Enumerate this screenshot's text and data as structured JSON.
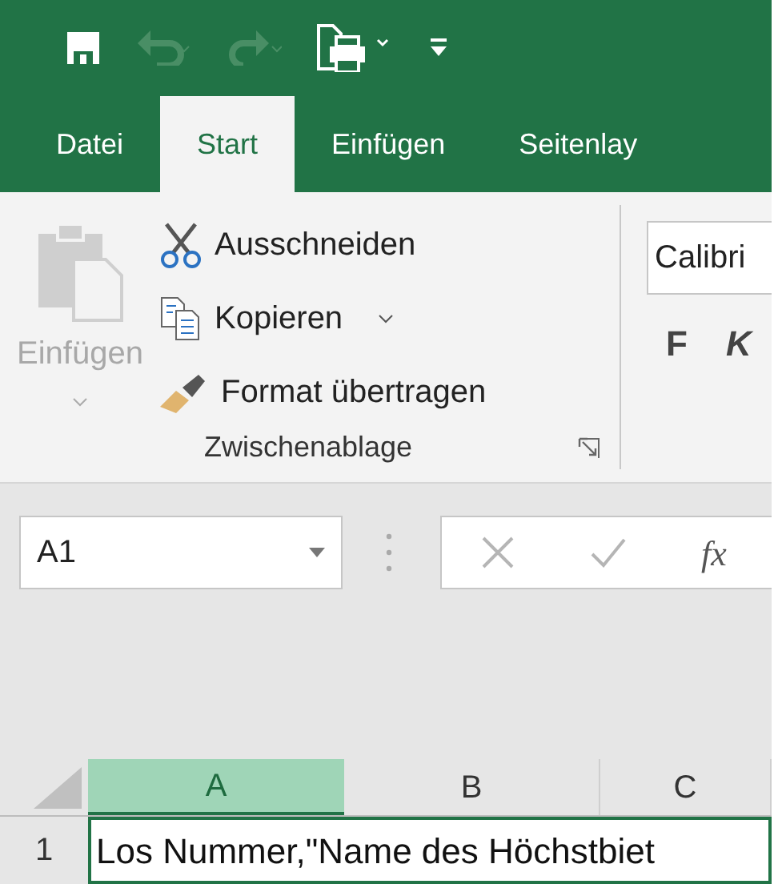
{
  "quick_access_toolbar": [
    {
      "kind": "save",
      "disabled": false
    },
    {
      "kind": "undo",
      "disabled": true
    },
    {
      "kind": "redo",
      "disabled": true
    },
    {
      "kind": "print-preview",
      "disabled": false
    },
    {
      "kind": "customize",
      "disabled": false
    }
  ],
  "tabs": [
    {
      "label": "Datei",
      "selected": false
    },
    {
      "label": "Start",
      "selected": true
    },
    {
      "label": "Einfügen",
      "selected": false
    },
    {
      "label": "Seitenlay",
      "selected": false
    }
  ],
  "clipboard_group": {
    "paste": {
      "label": "Einfügen",
      "disabled": true
    },
    "commands": [
      {
        "kind": "cut",
        "label": "Ausschneiden",
        "has_dropdown": false
      },
      {
        "kind": "copy",
        "label": "Kopieren",
        "has_dropdown": true
      },
      {
        "kind": "format-painter",
        "label": "Format übertragen",
        "has_dropdown": false
      }
    ],
    "label": "Zwischenablage"
  },
  "font_group": {
    "font_name": "Calibri",
    "buttons": [
      "F",
      "K"
    ]
  },
  "name_box": {
    "value": "A1"
  },
  "formula_bar": {
    "function_label": "fx"
  },
  "columns": [
    {
      "label": "A",
      "selected": true
    },
    {
      "label": "B",
      "selected": false
    },
    {
      "label": "C",
      "selected": false
    }
  ],
  "rows": [
    {
      "header": "1",
      "cells": [
        {
          "value": "Los Nummer,\"Name des Höchstbiet",
          "selected": true
        }
      ]
    }
  ]
}
